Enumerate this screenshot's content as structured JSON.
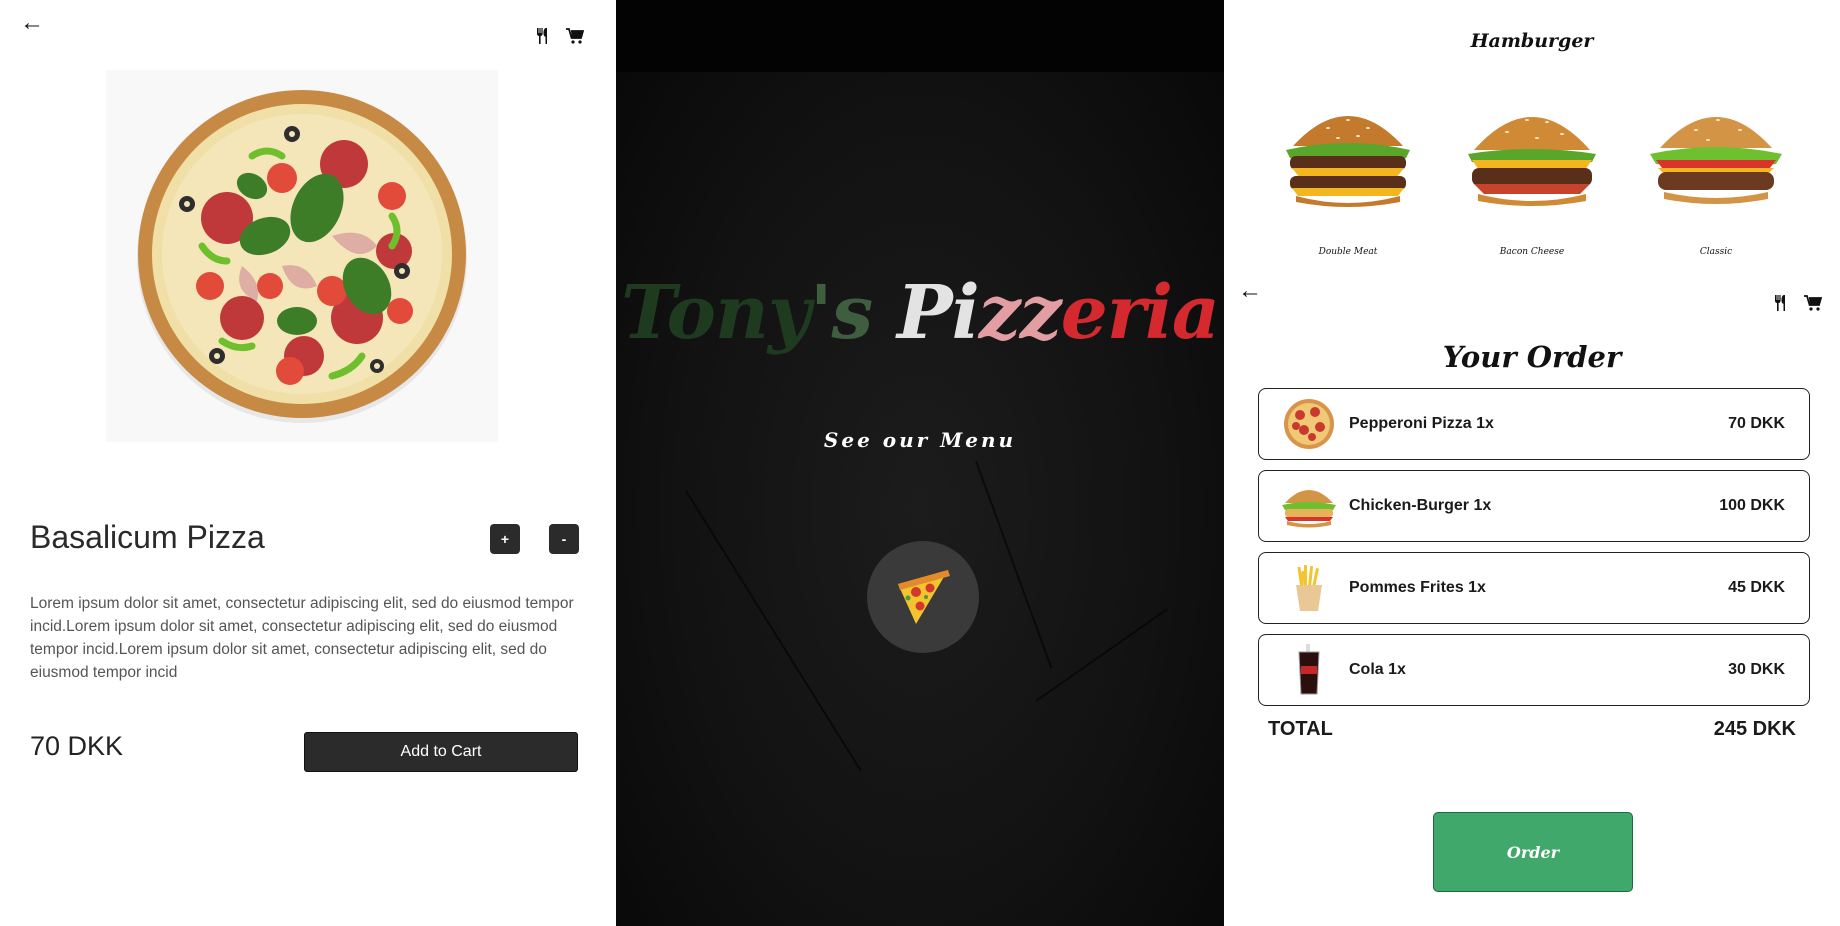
{
  "product": {
    "back_icon": "arrow-left-icon",
    "menu_icon": "utensils-icon",
    "cart_icon": "cart-icon",
    "image_alt": "pizza",
    "title": "Basalicum Pizza",
    "plus_label": "+",
    "minus_label": "-",
    "description": "Lorem ipsum dolor sit amet, consectetur adipiscing elit, sed do eiusmod tempor incid.Lorem ipsum dolor sit amet, consectetur adipiscing elit, sed do eiusmod tempor incid.Lorem ipsum dolor sit amet, consectetur adipiscing elit, sed do eiusmod tempor incid",
    "price": "70 DKK",
    "add_to_cart_label": "Add to Cart"
  },
  "landing": {
    "brand_part1": "Tony",
    "brand_part2": "'s ",
    "brand_part3": "Pi",
    "brand_part4": "zz",
    "brand_part5": "eria",
    "see_menu_label": "See our Menu",
    "menu_icon": "pizza-slice-icon"
  },
  "menu": {
    "category_title": "Hamburger",
    "items": [
      {
        "label": "Double Meat"
      },
      {
        "label": "Bacon Cheese"
      },
      {
        "label": "Classic"
      }
    ]
  },
  "order": {
    "title": "Your Order",
    "rows": [
      {
        "name": "Pepperoni Pizza 1x",
        "price": "70 DKK",
        "icon": "pizza-icon"
      },
      {
        "name": "Chicken-Burger 1x",
        "price": "100 DKK",
        "icon": "burger-icon"
      },
      {
        "name": "Pommes Frites 1x",
        "price": "45 DKK",
        "icon": "fries-icon"
      },
      {
        "name": "Cola 1x",
        "price": "30 DKK",
        "icon": "cola-icon"
      }
    ],
    "total_label": "TOTAL",
    "total_value": "245 DKK",
    "order_button_label": "Order"
  },
  "colors": {
    "dark_button": "#2b2b2b",
    "order_green": "#41a86b",
    "brand_green": "#1f3b1f",
    "brand_white": "#e3e3e3",
    "brand_red": "#d42a2f"
  }
}
